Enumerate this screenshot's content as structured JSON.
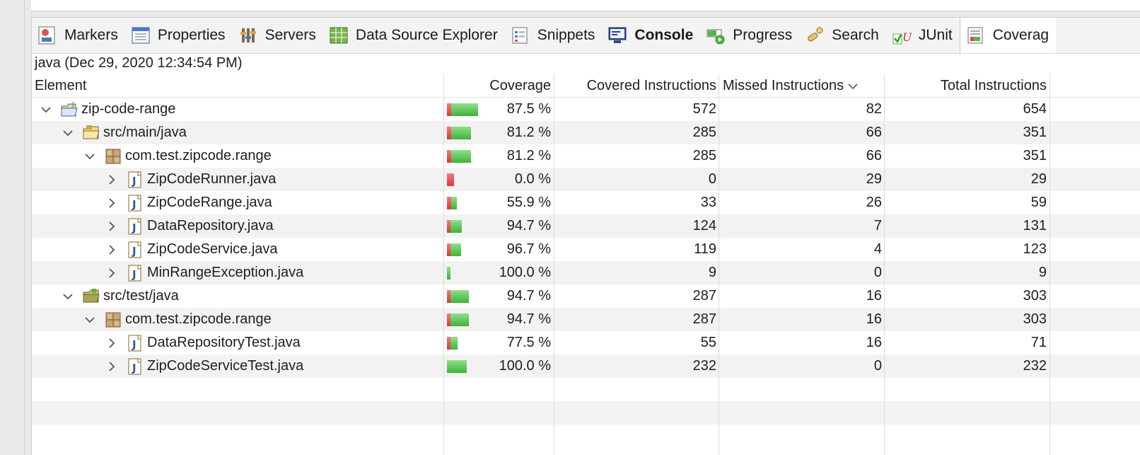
{
  "tabs": [
    {
      "label": "Markers",
      "icon": "markers-icon"
    },
    {
      "label": "Properties",
      "icon": "properties-icon"
    },
    {
      "label": "Servers",
      "icon": "servers-icon"
    },
    {
      "label": "Data Source Explorer",
      "icon": "data-source-explorer-icon"
    },
    {
      "label": "Snippets",
      "icon": "snippets-icon"
    },
    {
      "label": "Console",
      "icon": "console-icon",
      "bold": true
    },
    {
      "label": "Progress",
      "icon": "progress-icon"
    },
    {
      "label": "Search",
      "icon": "search-icon"
    },
    {
      "label": "JUnit",
      "icon": "junit-icon"
    },
    {
      "label": "Coverag",
      "icon": "coverage-icon",
      "active": true
    }
  ],
  "session_title": "java (Dec 29, 2020 12:34:54 PM)",
  "columns": {
    "element": "Element",
    "coverage": "Coverage",
    "covered": "Covered Instructions",
    "missed": "Missed Instructions",
    "total": "Total Instructions"
  },
  "rows": [
    {
      "name": "zip-code-range",
      "level": 0,
      "kind": "project",
      "expanded": true,
      "coverage": "87.5 %",
      "covered": "572",
      "missed": "82",
      "total": "654",
      "covered_fraction": 0.875
    },
    {
      "name": "src/main/java",
      "level": 1,
      "kind": "source-folder",
      "expanded": true,
      "coverage": "81.2 %",
      "covered": "285",
      "missed": "66",
      "total": "351",
      "covered_fraction": 0.812
    },
    {
      "name": "com.test.zipcode.range",
      "level": 2,
      "kind": "package",
      "expanded": true,
      "coverage": "81.2 %",
      "covered": "285",
      "missed": "66",
      "total": "351",
      "covered_fraction": 0.812
    },
    {
      "name": "ZipCodeRunner.java",
      "level": 3,
      "kind": "java-file",
      "expanded": false,
      "coverage": "0.0 %",
      "covered": "0",
      "missed": "29",
      "total": "29",
      "covered_fraction": 0.0
    },
    {
      "name": "ZipCodeRange.java",
      "level": 3,
      "kind": "java-file",
      "expanded": false,
      "coverage": "55.9 %",
      "covered": "33",
      "missed": "26",
      "total": "59",
      "covered_fraction": 0.559
    },
    {
      "name": "DataRepository.java",
      "level": 3,
      "kind": "java-file",
      "expanded": false,
      "coverage": "94.7 %",
      "covered": "124",
      "missed": "7",
      "total": "131",
      "covered_fraction": 0.947
    },
    {
      "name": "ZipCodeService.java",
      "level": 3,
      "kind": "java-file",
      "expanded": false,
      "coverage": "96.7 %",
      "covered": "119",
      "missed": "4",
      "total": "123",
      "covered_fraction": 0.967
    },
    {
      "name": "MinRangeException.java",
      "level": 3,
      "kind": "java-file",
      "expanded": false,
      "coverage": "100.0 %",
      "covered": "9",
      "missed": "0",
      "total": "9",
      "covered_fraction": 1.0
    },
    {
      "name": "src/test/java",
      "level": 1,
      "kind": "test-source-folder",
      "expanded": true,
      "coverage": "94.7 %",
      "covered": "287",
      "missed": "16",
      "total": "303",
      "covered_fraction": 0.947
    },
    {
      "name": "com.test.zipcode.range",
      "level": 2,
      "kind": "package",
      "expanded": true,
      "coverage": "94.7 %",
      "covered": "287",
      "missed": "16",
      "total": "303",
      "covered_fraction": 0.947
    },
    {
      "name": "DataRepositoryTest.java",
      "level": 3,
      "kind": "java-file",
      "expanded": false,
      "coverage": "77.5 %",
      "covered": "55",
      "missed": "16",
      "total": "71",
      "covered_fraction": 0.775
    },
    {
      "name": "ZipCodeServiceTest.java",
      "level": 3,
      "kind": "java-file",
      "expanded": false,
      "coverage": "100.0 %",
      "covered": "232",
      "missed": "0",
      "total": "232",
      "covered_fraction": 1.0
    }
  ],
  "colors": {
    "covered": "#4cbb47",
    "missed": "#e04848",
    "row_alt": "#f2f2f2"
  }
}
